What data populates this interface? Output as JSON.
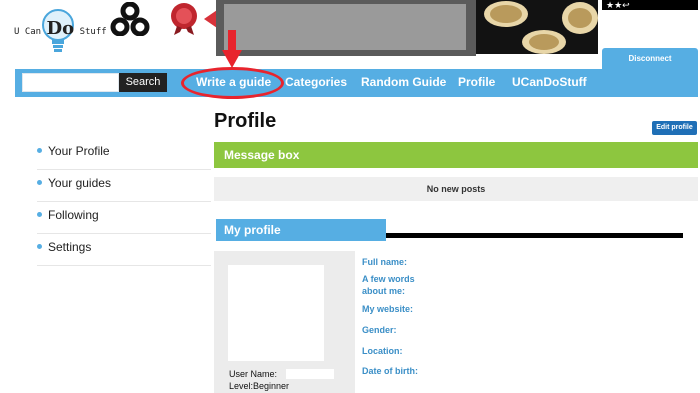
{
  "header": {
    "logo_text_pre": "U Can",
    "logo_text_big": "Do",
    "logo_text_post": "Stuff",
    "top_right_text": "★★↩",
    "disconnect_label": "Disconnect"
  },
  "search": {
    "placeholder": "",
    "value": "",
    "button_label": "Search"
  },
  "nav": {
    "items": [
      {
        "label": "Write a guide"
      },
      {
        "label": "Categories"
      },
      {
        "label": "Random Guide"
      },
      {
        "label": "Profile"
      },
      {
        "label": "UCanDoStuff"
      }
    ]
  },
  "sidebar": {
    "items": [
      {
        "label": "Your Profile"
      },
      {
        "label": "Your guides"
      },
      {
        "label": "Following"
      },
      {
        "label": "Settings"
      }
    ]
  },
  "main": {
    "title": "Profile",
    "edit_button": "Edit profile",
    "message_box_title": "Message box",
    "message_box_text": "No new posts",
    "my_profile_title": "My profile",
    "user_name_label": "User Name:",
    "level_text": "Level:Beginner",
    "fields": [
      {
        "label": "Full name:"
      },
      {
        "label": "A few words about me:"
      },
      {
        "label": "My website:"
      },
      {
        "label": "Gender:"
      },
      {
        "label": "Location:"
      },
      {
        "label": "Date of birth:"
      }
    ]
  },
  "colors": {
    "accent_blue": "#56aee3",
    "message_green": "#8dc63f",
    "annotation_red": "#e8242d",
    "edit_button_blue": "#1f6fb6"
  }
}
